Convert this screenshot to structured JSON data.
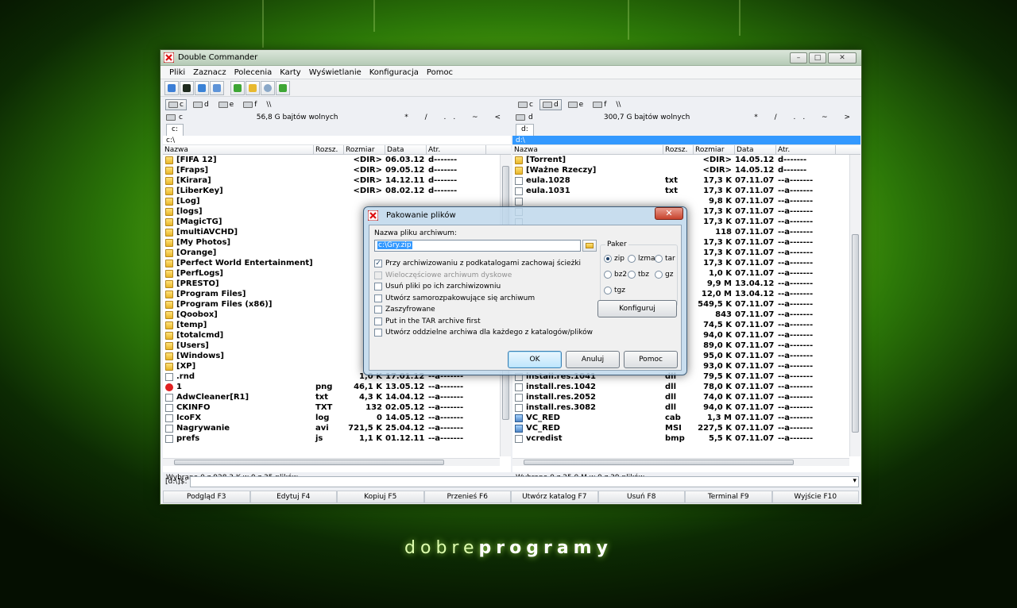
{
  "window": {
    "title": "Double Commander"
  },
  "menu": [
    "Pliki",
    "Zaznacz",
    "Polecenia",
    "Karty",
    "Wyświetlanie",
    "Konfiguracja",
    "Pomoc"
  ],
  "drives": {
    "left": [
      "c",
      "d",
      "e",
      "f",
      "\\\\"
    ],
    "right": [
      "c",
      "d",
      "e",
      "f",
      "\\\\"
    ],
    "left_active": "c",
    "right_active": "d"
  },
  "left_panel": {
    "drive": "c",
    "free": "56,8 G bajtów wolnych",
    "nav": "* / .. ~ <",
    "tab": "c:",
    "path": "c:\\",
    "columns": [
      "Nazwa",
      "Rozsz.",
      "Rozmiar",
      "Data",
      "Atr."
    ],
    "rows": [
      {
        "icon": "folder",
        "name": "[FIFA 12]",
        "ext": "",
        "size": "<DIR>",
        "date": "06.03.12",
        "attr": "d-------"
      },
      {
        "icon": "folder",
        "name": "[Fraps]",
        "ext": "",
        "size": "<DIR>",
        "date": "09.05.12",
        "attr": "d-------"
      },
      {
        "icon": "folder",
        "name": "[Kirara]",
        "ext": "",
        "size": "<DIR>",
        "date": "14.12.11",
        "attr": "d-------"
      },
      {
        "icon": "folder",
        "name": "[LiberKey]",
        "ext": "",
        "size": "<DIR>",
        "date": "08.02.12",
        "attr": "d-------"
      },
      {
        "icon": "folder",
        "name": "[Log]",
        "ext": "",
        "size": "",
        "date": "",
        "attr": ""
      },
      {
        "icon": "folder",
        "name": "[logs]",
        "ext": "",
        "size": "",
        "date": "",
        "attr": ""
      },
      {
        "icon": "folder",
        "name": "[MagicTG]",
        "ext": "",
        "size": "",
        "date": "",
        "attr": ""
      },
      {
        "icon": "folder",
        "name": "[multiAVCHD]",
        "ext": "",
        "size": "",
        "date": "",
        "attr": ""
      },
      {
        "icon": "folder",
        "name": "[My Photos]",
        "ext": "",
        "size": "",
        "date": "",
        "attr": ""
      },
      {
        "icon": "folder",
        "name": "[Orange]",
        "ext": "",
        "size": "",
        "date": "",
        "attr": ""
      },
      {
        "icon": "folder",
        "name": "[Perfect World Entertainment]",
        "ext": "",
        "size": "",
        "date": "",
        "attr": ""
      },
      {
        "icon": "folder",
        "name": "[PerfLogs]",
        "ext": "",
        "size": "",
        "date": "",
        "attr": ""
      },
      {
        "icon": "folder",
        "name": "[PRESTO]",
        "ext": "",
        "size": "",
        "date": "",
        "attr": ""
      },
      {
        "icon": "folder",
        "name": "[Program Files]",
        "ext": "",
        "size": "",
        "date": "",
        "attr": ""
      },
      {
        "icon": "folder",
        "name": "[Program Files (x86)]",
        "ext": "",
        "size": "",
        "date": "",
        "attr": ""
      },
      {
        "icon": "folder",
        "name": "[Qoobox]",
        "ext": "",
        "size": "",
        "date": "",
        "attr": ""
      },
      {
        "icon": "folder",
        "name": "[temp]",
        "ext": "",
        "size": "",
        "date": "",
        "attr": ""
      },
      {
        "icon": "folder",
        "name": "[totalcmd]",
        "ext": "",
        "size": "",
        "date": "",
        "attr": ""
      },
      {
        "icon": "folder",
        "name": "[Users]",
        "ext": "",
        "size": "",
        "date": "",
        "attr": ""
      },
      {
        "icon": "folder",
        "name": "[Windows]",
        "ext": "",
        "size": "",
        "date": "",
        "attr": ""
      },
      {
        "icon": "folder",
        "name": "[XP]",
        "ext": "",
        "size": "",
        "date": "",
        "attr": ""
      },
      {
        "icon": "file",
        "name": ".rnd",
        "ext": "",
        "size": "1,0 K",
        "date": "17.01.12",
        "attr": "--a-------"
      },
      {
        "icon": "star",
        "name": "1",
        "ext": "png",
        "size": "46,1 K",
        "date": "13.05.12",
        "attr": "--a-------"
      },
      {
        "icon": "file",
        "name": "AdwCleaner[R1]",
        "ext": "txt",
        "size": "4,3 K",
        "date": "14.04.12",
        "attr": "--a-------"
      },
      {
        "icon": "file",
        "name": "CKINFO",
        "ext": "TXT",
        "size": "132",
        "date": "02.05.12",
        "attr": "--a-------"
      },
      {
        "icon": "file",
        "name": "IcoFX",
        "ext": "log",
        "size": "0",
        "date": "14.05.12",
        "attr": "--a-------"
      },
      {
        "icon": "file",
        "name": "Nagrywanie",
        "ext": "avi",
        "size": "721,5 K",
        "date": "25.04.12",
        "attr": "--a-------"
      },
      {
        "icon": "file",
        "name": "prefs",
        "ext": "js",
        "size": "1,1 K",
        "date": "01.12.11",
        "attr": "--a-------"
      }
    ],
    "status": "Wybrano 0 z 928,3 K w 0 z 35 plików"
  },
  "right_panel": {
    "drive": "d",
    "free": "300,7 G bajtów wolnych",
    "nav": "* / .. ~ >",
    "tab": "d:",
    "path": "d:\\",
    "columns": [
      "Nazwa",
      "Rozsz.",
      "Rozmiar",
      "Data",
      "Atr."
    ],
    "rows": [
      {
        "icon": "folder",
        "name": "[Torrent]",
        "ext": "",
        "size": "<DIR>",
        "date": "14.05.12",
        "attr": "d-------"
      },
      {
        "icon": "folder",
        "name": "[Ważne Rzeczy]",
        "ext": "",
        "size": "<DIR>",
        "date": "14.05.12",
        "attr": "d-------"
      },
      {
        "icon": "file",
        "name": "eula.1028",
        "ext": "txt",
        "size": "17,3 K",
        "date": "07.11.07",
        "attr": "--a-------"
      },
      {
        "icon": "file",
        "name": "eula.1031",
        "ext": "txt",
        "size": "17,3 K",
        "date": "07.11.07",
        "attr": "--a-------"
      },
      {
        "icon": "file",
        "name": "",
        "ext": "",
        "size": "9,8 K",
        "date": "07.11.07",
        "attr": "--a-------"
      },
      {
        "icon": "file",
        "name": "",
        "ext": "",
        "size": "17,3 K",
        "date": "07.11.07",
        "attr": "--a-------"
      },
      {
        "icon": "file",
        "name": "",
        "ext": "",
        "size": "17,3 K",
        "date": "07.11.07",
        "attr": "--a-------"
      },
      {
        "icon": "file",
        "name": "",
        "ext": "",
        "size": "118",
        "date": "07.11.07",
        "attr": "--a-------"
      },
      {
        "icon": "file",
        "name": "",
        "ext": "",
        "size": "17,3 K",
        "date": "07.11.07",
        "attr": "--a-------"
      },
      {
        "icon": "file",
        "name": "",
        "ext": "",
        "size": "17,3 K",
        "date": "07.11.07",
        "attr": "--a-------"
      },
      {
        "icon": "file",
        "name": "",
        "ext": "",
        "size": "17,3 K",
        "date": "07.11.07",
        "attr": "--a-------"
      },
      {
        "icon": "file",
        "name": "",
        "ext": "",
        "size": "1,0 K",
        "date": "07.11.07",
        "attr": "--a-------"
      },
      {
        "icon": "file",
        "name": "",
        "ext": "",
        "size": "9,9 M",
        "date": "13.04.12",
        "attr": "--a-------"
      },
      {
        "icon": "file",
        "name": "",
        "ext": "",
        "size": "12,0 M",
        "date": "13.04.12",
        "attr": "--a-------"
      },
      {
        "icon": "file",
        "name": "",
        "ext": "",
        "size": "549,5 K",
        "date": "07.11.07",
        "attr": "--a-------"
      },
      {
        "icon": "file",
        "name": "",
        "ext": "",
        "size": "843",
        "date": "07.11.07",
        "attr": "--a-------"
      },
      {
        "icon": "file",
        "name": "",
        "ext": "",
        "size": "74,5 K",
        "date": "07.11.07",
        "attr": "--a-------"
      },
      {
        "icon": "file",
        "name": "",
        "ext": "",
        "size": "94,0 K",
        "date": "07.11.07",
        "attr": "--a-------"
      },
      {
        "icon": "file",
        "name": "",
        "ext": "",
        "size": "89,0 K",
        "date": "07.11.07",
        "attr": "--a-------"
      },
      {
        "icon": "file",
        "name": "",
        "ext": "",
        "size": "95,0 K",
        "date": "07.11.07",
        "attr": "--a-------"
      },
      {
        "icon": "file",
        "name": "",
        "ext": "",
        "size": "93,0 K",
        "date": "07.11.07",
        "attr": "--a-------"
      },
      {
        "icon": "file",
        "name": "install.res.1041",
        "ext": "dll",
        "size": "79,5 K",
        "date": "07.11.07",
        "attr": "--a-------"
      },
      {
        "icon": "file",
        "name": "install.res.1042",
        "ext": "dll",
        "size": "78,0 K",
        "date": "07.11.07",
        "attr": "--a-------"
      },
      {
        "icon": "file",
        "name": "install.res.2052",
        "ext": "dll",
        "size": "74,0 K",
        "date": "07.11.07",
        "attr": "--a-------"
      },
      {
        "icon": "file",
        "name": "install.res.3082",
        "ext": "dll",
        "size": "94,0 K",
        "date": "07.11.07",
        "attr": "--a-------"
      },
      {
        "icon": "exe",
        "name": "VC_RED",
        "ext": "cab",
        "size": "1,3 M",
        "date": "07.11.07",
        "attr": "--a-------"
      },
      {
        "icon": "exe",
        "name": "VC_RED",
        "ext": "MSI",
        "size": "227,5 K",
        "date": "07.11.07",
        "attr": "--a-------"
      },
      {
        "icon": "file",
        "name": "vcredist",
        "ext": "bmp",
        "size": "5,5 K",
        "date": "07.11.07",
        "attr": "--a-------"
      }
    ],
    "status": "Wybrano 0 z 25,0 M w 0 z 39 plików"
  },
  "cmdline": {
    "prompt": "[d:\\]$:",
    "value": ""
  },
  "fkeys": [
    "Podgląd F3",
    "Edytuj F4",
    "Kopiuj F5",
    "Przenieś F6",
    "Utwórz katalog F7",
    "Usuń F8",
    "Terminal F9",
    "Wyjście F10"
  ],
  "dialog": {
    "title": "Pakowanie plików",
    "name_label": "Nazwa pliku archiwum:",
    "archive_name": "c:\\Gry.zip",
    "options": [
      {
        "label": "Przy archiwizowaniu z podkatalogami zachowaj ścieżki",
        "checked": true,
        "disabled": false
      },
      {
        "label": "Wieloczęściowe archiwum dyskowe",
        "checked": false,
        "disabled": true
      },
      {
        "label": "Usuń pliki po ich zarchiwizowniu",
        "checked": false,
        "disabled": false
      },
      {
        "label": "Utwórz samorozpakowujące się archiwum",
        "checked": false,
        "disabled": false
      },
      {
        "label": "Zaszyfrowane",
        "checked": false,
        "disabled": false
      },
      {
        "label": "Put in the TAR archive first",
        "checked": false,
        "disabled": false
      },
      {
        "label": "Utwórz oddzielne archiwa dla każdego z katalogów/plików",
        "checked": false,
        "disabled": false
      }
    ],
    "packer_label": "Paker",
    "packers": [
      "zip",
      "lzma",
      "tar",
      "bz2",
      "tbz",
      "gz",
      "tgz"
    ],
    "packer_selected": "zip",
    "configure": "Konfiguruj",
    "ok": "OK",
    "cancel": "Anuluj",
    "help": "Pomoc"
  },
  "brand": {
    "light": "dobre",
    "bold": "programy"
  }
}
